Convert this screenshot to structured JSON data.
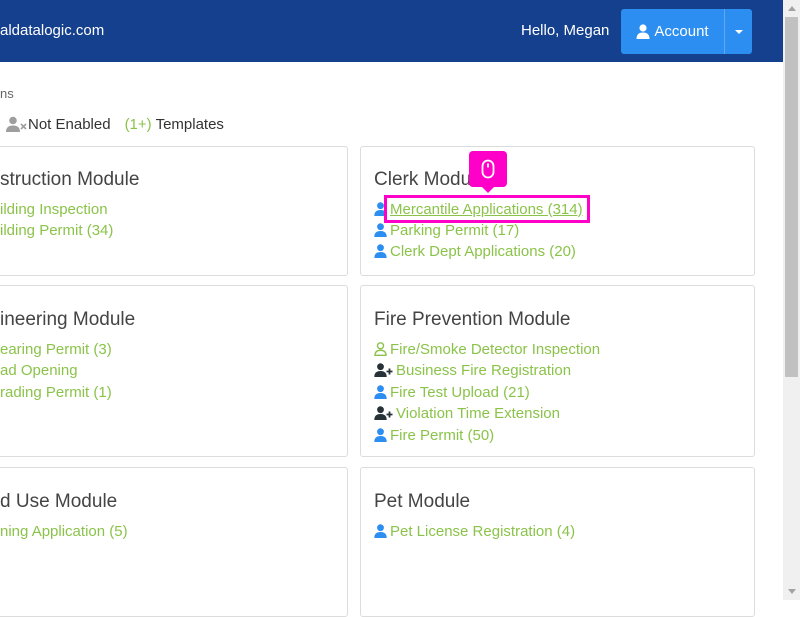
{
  "header": {
    "site_name": "aldatalogic.com",
    "greeting": "Hello, Megan",
    "account_label": "Account"
  },
  "toolbar": {
    "truncated_label": "ns",
    "not_enabled_label": "Not Enabled",
    "templates_count": "(1+)",
    "templates_label": "Templates"
  },
  "cards": {
    "construction": {
      "title": "struction Module",
      "items": [
        "ilding Inspection",
        "ilding Permit (34)"
      ]
    },
    "clerk": {
      "title": "Clerk Module",
      "items": [
        "Mercantile Applications (314)",
        "Parking Permit (17)",
        "Clerk Dept Applications (20)"
      ]
    },
    "engineering": {
      "title": "ineering Module",
      "items": [
        "earing Permit (3)",
        "ad Opening",
        "rading Permit (1)"
      ]
    },
    "fire": {
      "title": "Fire Prevention Module",
      "items": [
        "Fire/Smoke Detector Inspection",
        "Business Fire Registration",
        "Fire Test Upload (21)",
        "Violation Time Extension",
        "Fire Permit (50)"
      ]
    },
    "landuse": {
      "title": "d Use Module",
      "items": [
        "ning Application (5)"
      ]
    },
    "pet": {
      "title": "Pet Module",
      "items": [
        "Pet License Registration (4)"
      ]
    }
  },
  "colors": {
    "header_bg": "#15408e",
    "account_button": "#2c8ef0",
    "link_green": "#8bc34a",
    "user_icon_blue": "#2c8ef0",
    "highlight_magenta": "#ff00c8"
  },
  "icons": {
    "user": "user-icon",
    "user_outline": "user-outline-icon",
    "user_plus": "user-plus-icon",
    "user_times": "user-times-icon",
    "mouse": "mouse-icon"
  }
}
